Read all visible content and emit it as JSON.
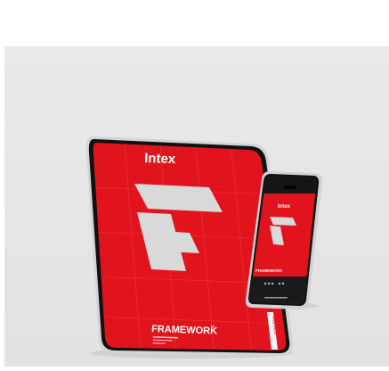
{
  "tablet": {
    "brand": "Intex",
    "product": "FRAMEWORK",
    "tm": "™",
    "side_tab": "Design Manual"
  },
  "phone": {
    "brand": "Intex",
    "product": "FRAMEWORK"
  },
  "colors": {
    "backdrop": "#ececec",
    "screen_red": "#e1141e",
    "logo_grey": "#d8d8d8",
    "device_frame": "#cfcfcf",
    "bezel": "#111111"
  }
}
